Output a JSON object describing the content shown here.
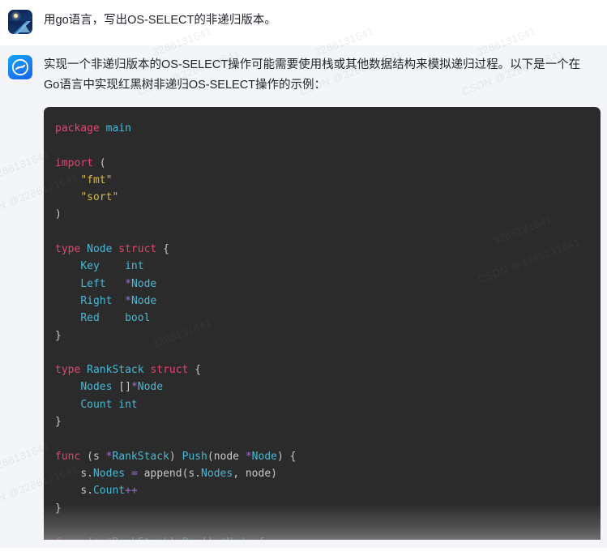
{
  "watermark": {
    "text": "3286131641",
    "text_alt": "CSDN @3286131641"
  },
  "conversation": {
    "messages": [
      {
        "role": "user",
        "avatar_icon": "night-landscape-avatar",
        "text": "用go语言，写出OS-SELECT的非递归版本。"
      },
      {
        "role": "assistant",
        "avatar_icon": "ai-assistant-avatar",
        "text": "实现一个非递归版本的OS-SELECT操作可能需要使用栈或其他数据结构来模拟递归过程。以下是一个在Go语言中实现红黑树非递归OS-SELECT操作的示例："
      }
    ]
  },
  "code_block": {
    "language": "go",
    "theme_background": "#2b2b2b",
    "colors": {
      "keyword": "#e8436f",
      "type": "#49b8d4",
      "string": "#d8b84a",
      "operator": "#a06fd8",
      "plain": "#c8c8c8"
    },
    "lines": [
      "package main",
      "",
      "import (",
      "    \"fmt\"",
      "    \"sort\"",
      ")",
      "",
      "type Node struct {",
      "    Key    int",
      "    Left   *Node",
      "    Right  *Node",
      "    Red    bool",
      "}",
      "",
      "type RankStack struct {",
      "    Nodes []*Node",
      "    Count int",
      "}",
      "",
      "func (s *RankStack) Push(node *Node) {",
      "    s.Nodes = append(s.Nodes, node)",
      "    s.Count++",
      "}",
      "",
      "func (s *RankStack) Pop() *Node {"
    ]
  }
}
